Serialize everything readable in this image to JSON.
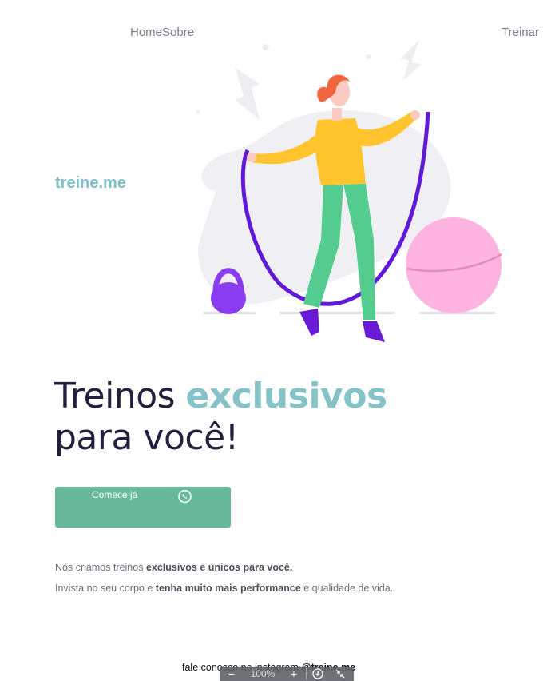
{
  "nav": {
    "home": "Home",
    "about": "Sobre",
    "train": "Treinar"
  },
  "brand": {
    "name": "treine.me"
  },
  "hero": {
    "headline_part1": "Treinos ",
    "headline_accent": "exclusivos",
    "headline_part2": "para você!"
  },
  "cta": {
    "label": "Comece já",
    "icon": "whatsapp-icon"
  },
  "description": {
    "line1_pre": "Nós criamos treinos ",
    "line1_bold": "exclusivos e únicos para você.",
    "line2_pre": "Invista no seu corpo e ",
    "line2_bold": "tenha muito mais performance",
    "line2_post": " e qualidade de vida."
  },
  "footer": {
    "text": "fale conosco no instagram ",
    "handle": "@treine.me"
  },
  "zoom_toolbar": {
    "minus": "−",
    "zoom_level": "100%",
    "plus": "+"
  },
  "colors": {
    "accent": "#86c3c9",
    "cta": "#67b99a",
    "headline": "#241f3d"
  }
}
